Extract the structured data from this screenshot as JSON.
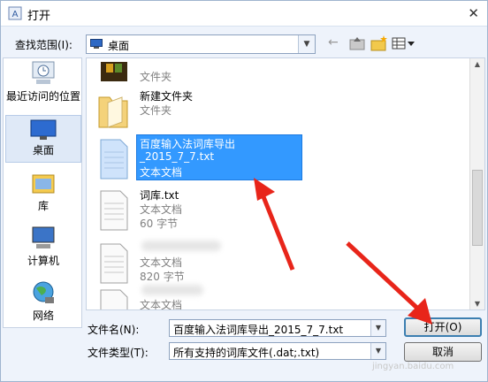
{
  "window": {
    "title": "打开",
    "close": "✕"
  },
  "lookin": {
    "label": "查找范围(I):",
    "value": "桌面"
  },
  "toolbar": {
    "back": "←"
  },
  "places": [
    {
      "label": "最近访问的位置"
    },
    {
      "label": "桌面"
    },
    {
      "label": "库"
    },
    {
      "label": "计算机"
    },
    {
      "label": "网络"
    }
  ],
  "files": [
    {
      "name": "",
      "line2": "文件夹",
      "line3": ""
    },
    {
      "name": "新建文件夹",
      "line2": "文件夹",
      "line3": ""
    },
    {
      "name": "百度输入法词库导出",
      "line2": "_2015_7_7.txt",
      "line3": "文本文档",
      "selected": true
    },
    {
      "name": "词库.txt",
      "line2": "文本文档",
      "line3": "60 字节"
    },
    {
      "name": "",
      "line2": "文本文档",
      "line3": "820 字节"
    },
    {
      "name": "",
      "line2": "文本文档",
      "line3": ""
    }
  ],
  "filename": {
    "label": "文件名(N):",
    "value": "百度输入法词库导出_2015_7_7.txt"
  },
  "filetype": {
    "label": "文件类型(T):",
    "value": "所有支持的词库文件(.dat;.txt)"
  },
  "buttons": {
    "open": "打开(O)",
    "cancel": "取消"
  },
  "watermark": "jingyan.baidu.com"
}
